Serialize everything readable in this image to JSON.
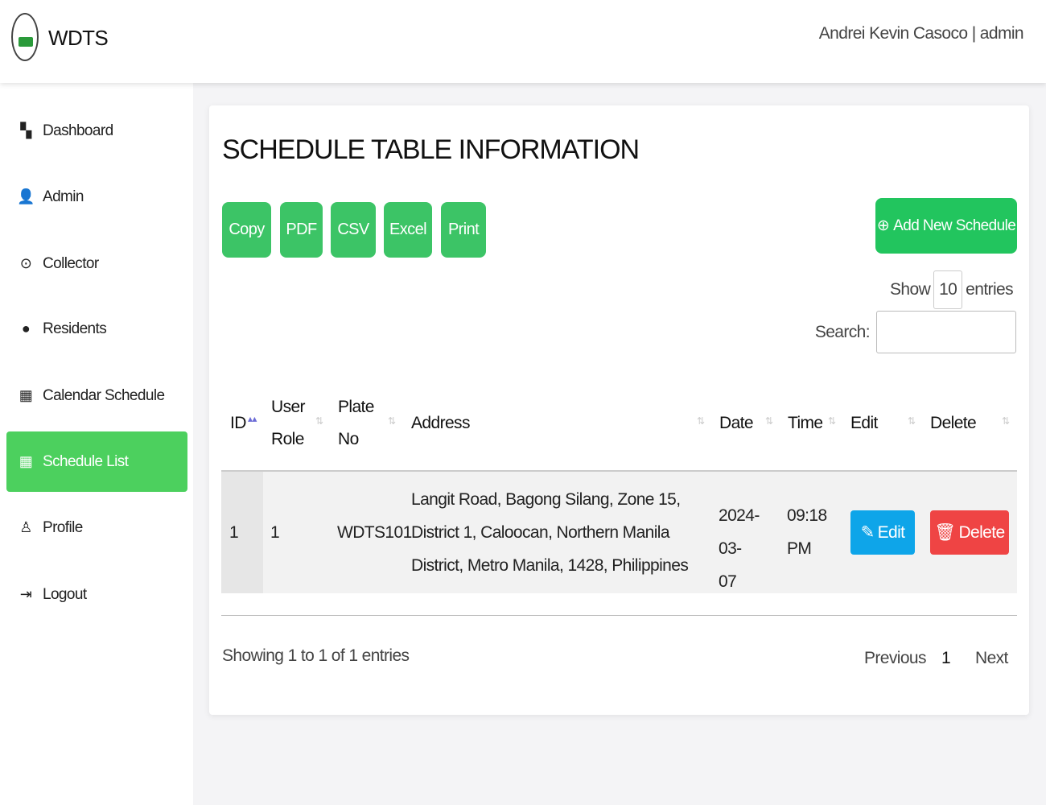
{
  "header": {
    "brand": "WDTS",
    "user": "Andrei Kevin Casoco | admin"
  },
  "sidebar": {
    "items": [
      {
        "label": "Dashboard",
        "icon": "dashboard-icon"
      },
      {
        "label": "Admin",
        "icon": "admin-icon"
      },
      {
        "label": "Collector",
        "icon": "location-pin-icon"
      },
      {
        "label": "Residents",
        "icon": "user-icon"
      },
      {
        "label": "Calendar Schedule",
        "icon": "calendar-icon"
      },
      {
        "label": "Schedule List",
        "icon": "calendar-list-icon",
        "active": true
      },
      {
        "label": "Profile",
        "icon": "profile-icon"
      },
      {
        "label": "Logout",
        "icon": "logout-icon"
      }
    ]
  },
  "main": {
    "title": "SCHEDULE TABLE INFORMATION",
    "export_buttons": [
      "Copy",
      "PDF",
      "CSV",
      "Excel",
      "Print"
    ],
    "add_button": "Add New Schedule",
    "show_label": "Show",
    "entries_value": "10",
    "entries_label": "entries",
    "search_label": "Search:",
    "search_value": "",
    "columns": [
      "ID",
      "User Role",
      "Plate No",
      "Address",
      "Date",
      "Time",
      "Edit",
      "Delete"
    ],
    "rows": [
      {
        "id": "1",
        "user_role": "1",
        "plate_no": "WDTS101",
        "address": "Langit Road, Bagong Silang, Zone 15, District 1, Caloocan, Northern Manila District, Metro Manila, 1428, Philippines",
        "date": "2024-03-07",
        "time": "09:18 PM",
        "edit": "Edit",
        "delete": "Delete"
      }
    ],
    "info": "Showing 1 to 1 of 1 entries",
    "pagination": {
      "previous": "Previous",
      "page": "1",
      "next": "Next"
    }
  },
  "colors": {
    "accent": "#4cd05e",
    "edit": "#0ea5e9",
    "delete": "#ef4444"
  }
}
